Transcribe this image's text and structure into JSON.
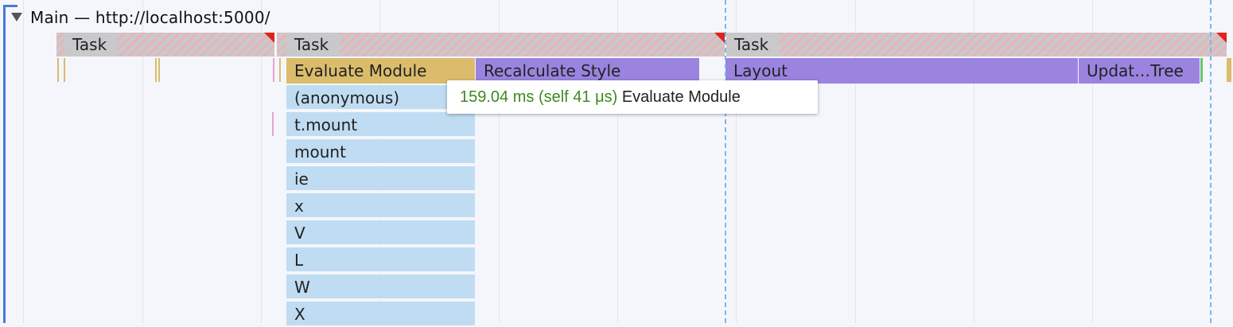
{
  "track": {
    "title": "Main — http://localhost:5000/"
  },
  "tasks": [
    {
      "label": "Task"
    },
    {
      "label": "Task"
    },
    {
      "label": "Task"
    }
  ],
  "slices": {
    "evaluate_module": "Evaluate Module",
    "recalculate_style": "Recalculate Style",
    "layout": "Layout",
    "update_tree": "Updat…Tree"
  },
  "call_stack": [
    "(anonymous)",
    "t.mount",
    "mount",
    "ie",
    "x",
    "V",
    "L",
    "W",
    "X"
  ],
  "tooltip": {
    "time": "159.04 ms (self 41 μs)",
    "name": "Evaluate Module"
  },
  "colors": {
    "task_hatch": "#e9b3b6",
    "task_grey": "#c9c9cc",
    "scripting": "#dbbc6c",
    "rendering": "#9b84e0",
    "js_frame": "#bfdcf2",
    "long_task_marker": "#e0231b",
    "tooltip_time": "#3b8b1f"
  }
}
